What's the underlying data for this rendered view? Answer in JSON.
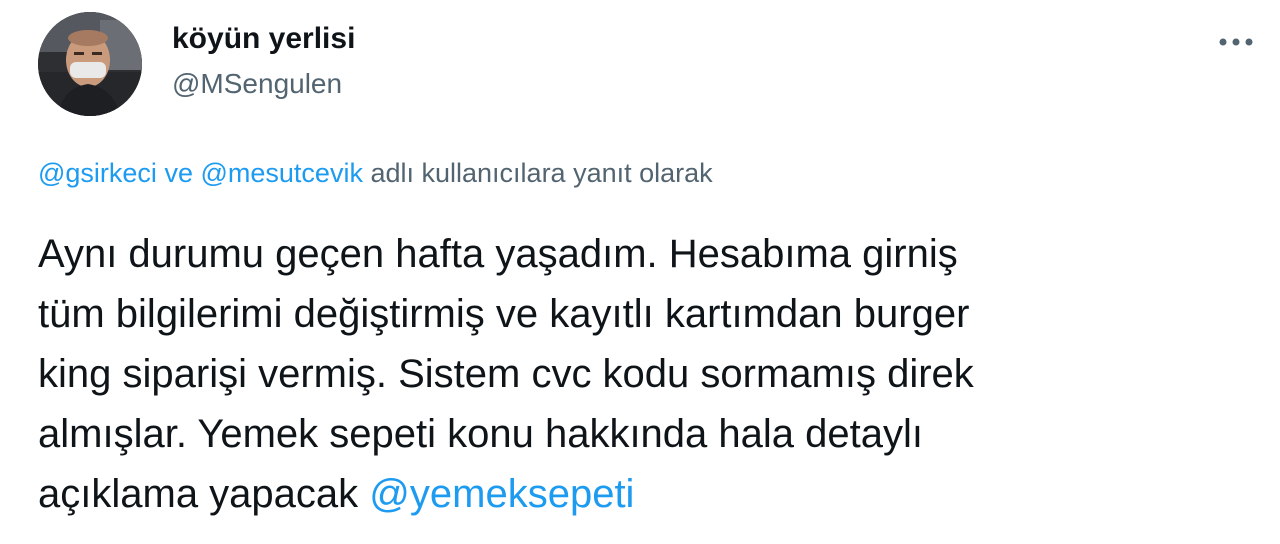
{
  "author": {
    "display_name": "köyün yerlisi",
    "handle": "@MSengulen"
  },
  "more_icon": "more-horizontal-icon",
  "reply": {
    "mention_1": "@gsirkeci",
    "conjunction": "ve",
    "mention_2": "@mesutcevik",
    "suffix": "adlı kullanıcılara yanıt olarak"
  },
  "tweet": {
    "lines": [
      "Aynı durumu geçen hafta yaşadım. Hesabıma girniş",
      "tüm bilgilerimi değiştirmiş ve kayıtlı kartımdan burger",
      "king siparişi vermiş. Sistem cvc kodu sormamış direk",
      "almışlar. Yemek sepeti konu hakkında hala detaylı"
    ],
    "last_line_prefix": "açıklama yapacak",
    "last_line_mention": "@yemeksepeti"
  },
  "colors": {
    "link": "#1d9bf0",
    "secondary_text": "#536471",
    "primary_text": "#0f1419"
  }
}
